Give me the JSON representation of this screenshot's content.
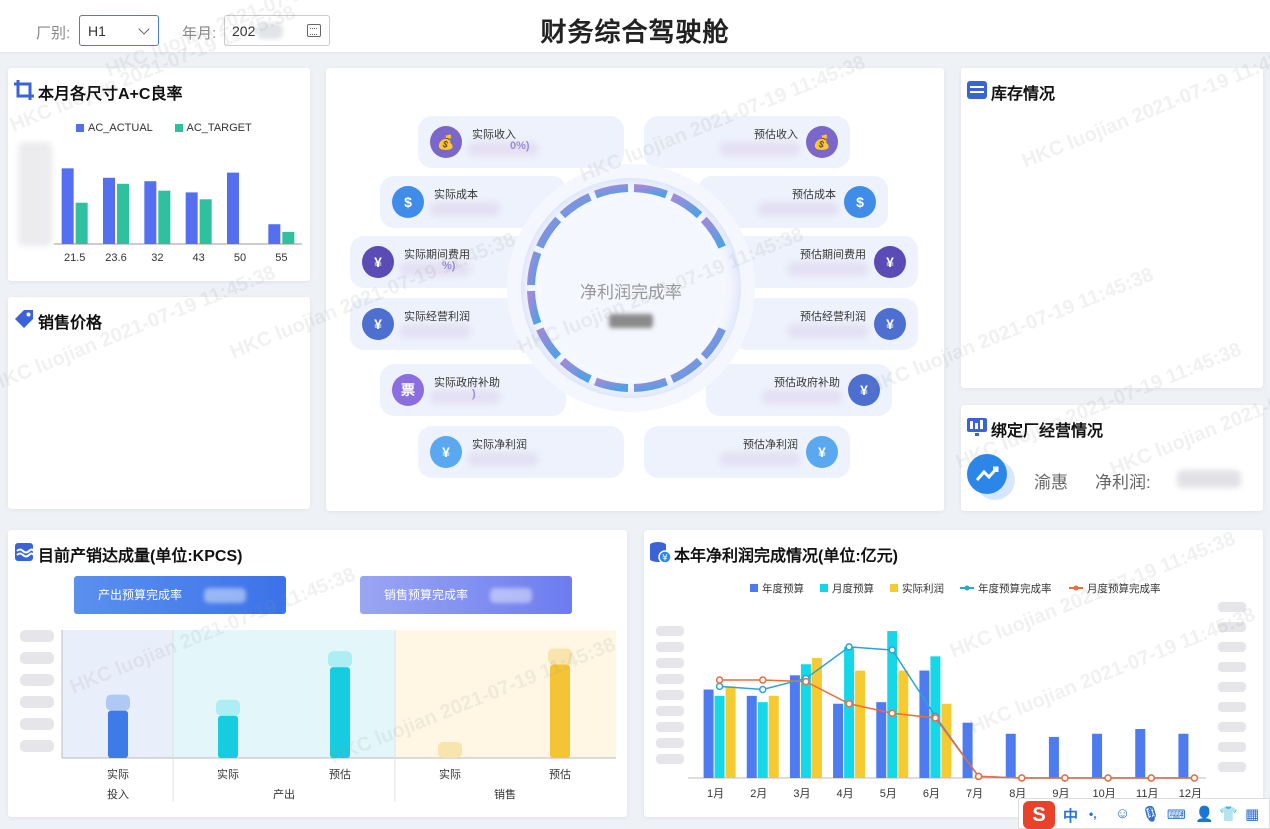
{
  "header": {
    "factory_label": "厂别:",
    "factory_value": "H1",
    "month_label": "年月:",
    "month_value": "202",
    "title": "财务综合驾驶舱"
  },
  "watermark": "HKC luojian 2021-07-19 11:45:38",
  "panels": {
    "ac_rate": {
      "title": "本月各尺寸A+C良率"
    },
    "price": {
      "title": "销售价格"
    },
    "inventory": {
      "title": "库存情况"
    },
    "bound": {
      "title": "绑定厂经营情况",
      "factory": "渝惠",
      "profit_label": "净利润:"
    },
    "production": {
      "title": "目前产销达成量(单位:KPCS)",
      "btn_production": "产出预算完成率",
      "btn_sales": "销售预算完成率"
    },
    "annual_profit": {
      "title": "本年净利润完成情况(单位:亿元)"
    }
  },
  "profit_center": {
    "ring_label": "净利润完成率",
    "left": [
      {
        "label": "实际收入",
        "pct": "0%)",
        "icon_color": "#7b67c9",
        "icon": "💰"
      },
      {
        "label": "实际成本",
        "pct": "",
        "icon_color": "#3f8de8",
        "icon": "$"
      },
      {
        "label": "实际期间费用",
        "pct": "%)",
        "icon_color": "#5a4bb5",
        "icon": "¥"
      },
      {
        "label": "实际经营利润",
        "pct": "",
        "icon_color": "#4d6fd0",
        "icon": "¥"
      },
      {
        "label": "实际政府补助",
        "pct": ")",
        "icon_color": "#8b6fe0",
        "icon": "票"
      },
      {
        "label": "实际净利润",
        "pct": "",
        "icon_color": "#5aa8f0",
        "icon": "¥"
      }
    ],
    "right": [
      {
        "label": "预估收入",
        "icon_color": "#7b67c9",
        "icon": "💰"
      },
      {
        "label": "预估成本",
        "icon_color": "#3f8de8",
        "icon": "$"
      },
      {
        "label": "预估期间费用",
        "icon_color": "#5a4bb5",
        "icon": "¥"
      },
      {
        "label": "预估经营利润",
        "icon_color": "#4d6fd0",
        "icon": "¥"
      },
      {
        "label": "预估政府补助",
        "icon_color": "#4d6fd0",
        "icon": "¥"
      },
      {
        "label": "预估净利润",
        "icon_color": "#5aa8f0",
        "icon": "¥"
      }
    ]
  },
  "chart_data": [
    {
      "type": "bar",
      "title": "本月各尺寸A+C良率",
      "categories": [
        "21.5",
        "23.6",
        "32",
        "43",
        "50",
        "55"
      ],
      "series": [
        {
          "name": "AC_ACTUAL",
          "color": "#5470f0",
          "values": [
            0.88,
            0.77,
            0.73,
            0.6,
            0.83,
            0.23
          ]
        },
        {
          "name": "AC_TARGET",
          "color": "#2fc0a0",
          "values": [
            0.48,
            0.7,
            0.62,
            0.52,
            0.0,
            0.14
          ]
        }
      ],
      "ylim": [
        0,
        1
      ]
    },
    {
      "type": "bar",
      "title": "目前产销达成量(单位:KPCS)",
      "categories": [
        "实际",
        "实际",
        "预估",
        "实际",
        "预估"
      ],
      "groups": [
        {
          "name": "投入",
          "span": 1
        },
        {
          "name": "产出",
          "span": 2
        },
        {
          "name": "销售",
          "span": 2
        }
      ],
      "values": [
        0.37,
        0.33,
        0.71,
        0.0,
        0.73
      ],
      "ylim": [
        0,
        1
      ]
    },
    {
      "type": "bar",
      "title": "本年净利润完成情况(单位:亿元)",
      "categories": [
        "1月",
        "2月",
        "3月",
        "4月",
        "5月",
        "6月",
        "7月",
        "8月",
        "9月",
        "10月",
        "11月",
        "12月"
      ],
      "series": [
        {
          "name": "年度预算",
          "color": "#4e7bef",
          "values": [
            0.56,
            0.52,
            0.65,
            0.47,
            0.48,
            0.68,
            0.35,
            0.28,
            0.26,
            0.28,
            0.31,
            0.28
          ]
        },
        {
          "name": "月度预算",
          "color": "#16d7e8",
          "values": [
            0.52,
            0.48,
            0.72,
            0.83,
            0.93,
            0.77,
            0,
            0,
            0,
            0,
            0,
            0
          ]
        },
        {
          "name": "实际利润",
          "color": "#f6cb32",
          "values": [
            0.58,
            0.52,
            0.76,
            0.68,
            0.68,
            0.47,
            0,
            0,
            0,
            0,
            0,
            0
          ]
        },
        {
          "name": "年度预算完成率",
          "color": "#2aa3d6",
          "kind": "line",
          "values": [
            0.58,
            0.56,
            0.63,
            0.83,
            0.81,
            0.39,
            0.01,
            0,
            0,
            0,
            0,
            0
          ]
        },
        {
          "name": "月度预算完成率",
          "color": "#ef6a3d",
          "kind": "line",
          "values": [
            0.62,
            0.62,
            0.61,
            0.47,
            0.41,
            0.38,
            0.01,
            0,
            0,
            0,
            0,
            0
          ]
        }
      ],
      "ylim": [
        0,
        1
      ]
    }
  ],
  "ime": {
    "logo": "S",
    "lang": "中"
  }
}
